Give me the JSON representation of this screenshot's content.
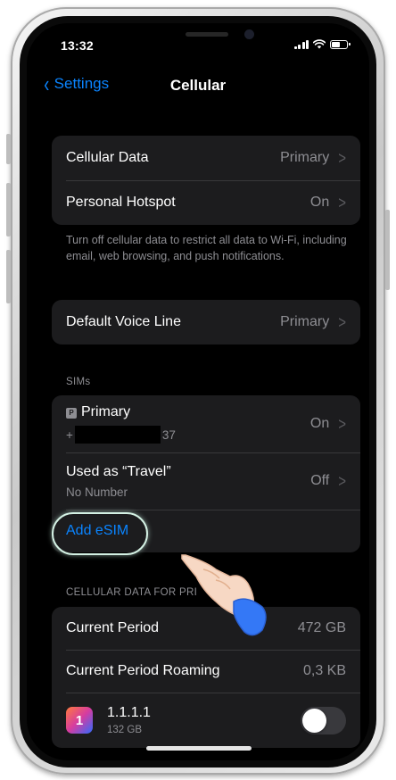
{
  "status_bar": {
    "time": "13:32"
  },
  "navbar": {
    "back_label": "Settings",
    "title": "Cellular"
  },
  "group1": {
    "rows": [
      {
        "label": "Cellular Data",
        "value": "Primary"
      },
      {
        "label": "Personal Hotspot",
        "value": "On"
      }
    ],
    "footnote": "Turn off cellular data to restrict all data to Wi-Fi, including email, web browsing, and push notifications."
  },
  "group2": {
    "label": "Default Voice Line",
    "value": "Primary"
  },
  "sims": {
    "header": "SIMs",
    "primary": {
      "badge": "P",
      "label": "Primary",
      "number_prefix": "+",
      "number_suffix": "37",
      "value": "On"
    },
    "travel": {
      "label": "Used as “Travel”",
      "sub": "No Number",
      "value": "Off"
    },
    "add_esim": "Add eSIM"
  },
  "data_section": {
    "header": "CELLULAR DATA FOR PRI",
    "rows": [
      {
        "label": "Current Period",
        "value": "472 GB"
      },
      {
        "label": "Current Period Roaming",
        "value": "0,3 KB"
      }
    ],
    "app": {
      "icon_text": "1",
      "name": "1.1.1.1",
      "usage": "132 GB",
      "toggle_on": false
    }
  },
  "colors": {
    "accent": "#0a84ff",
    "cell_bg": "#1c1c1e",
    "secondary_text": "#8e8e93"
  }
}
